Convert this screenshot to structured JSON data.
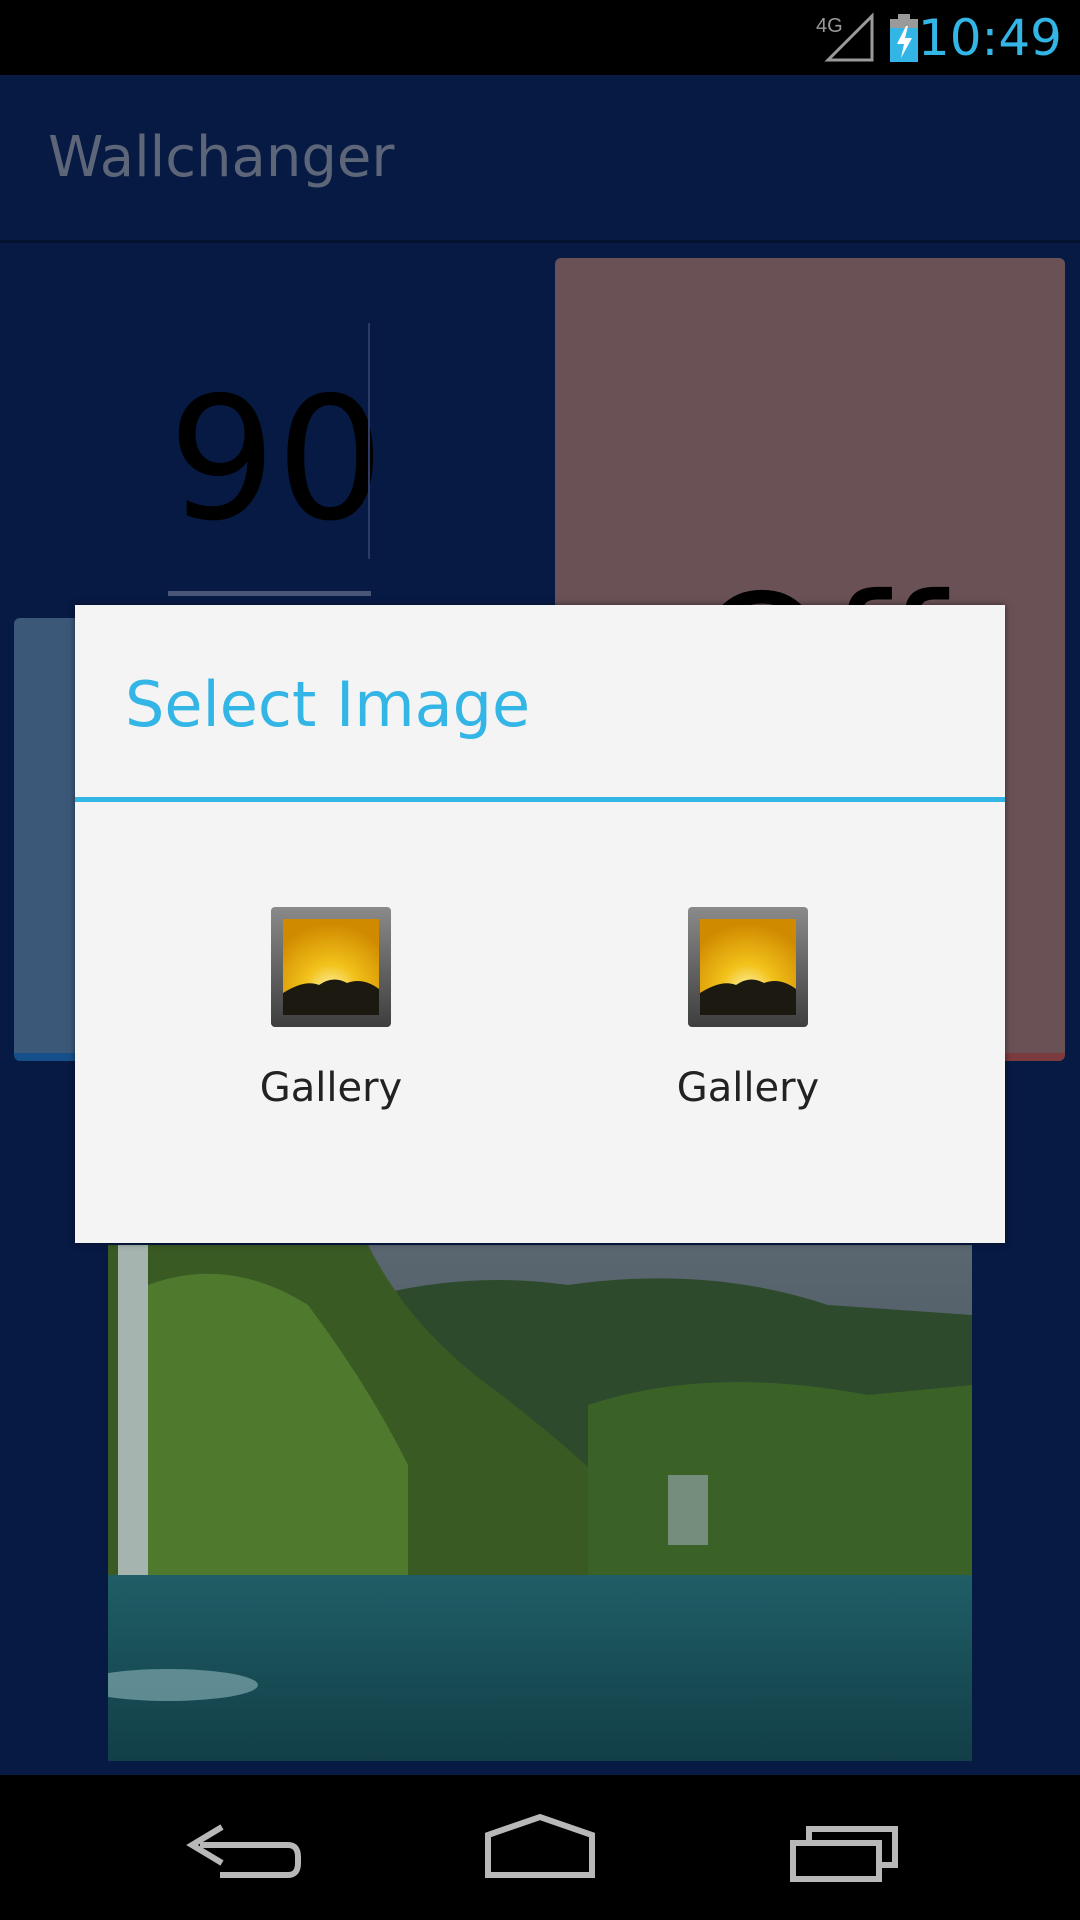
{
  "status_bar": {
    "network": "4G",
    "time": "10:49"
  },
  "app": {
    "title": "Wallchanger"
  },
  "main": {
    "interval_value": "90",
    "toggle_label": "Off"
  },
  "dialog": {
    "title": "Select Image",
    "options": [
      {
        "label": "Gallery",
        "icon": "gallery-icon"
      },
      {
        "label": "Gallery",
        "icon": "gallery-icon"
      }
    ]
  },
  "nav": {
    "buttons": [
      "back",
      "home",
      "recent-apps"
    ]
  },
  "colors": {
    "accent": "#33b5e5",
    "background": "#071a44",
    "dialog_bg": "#f4f4f4"
  }
}
